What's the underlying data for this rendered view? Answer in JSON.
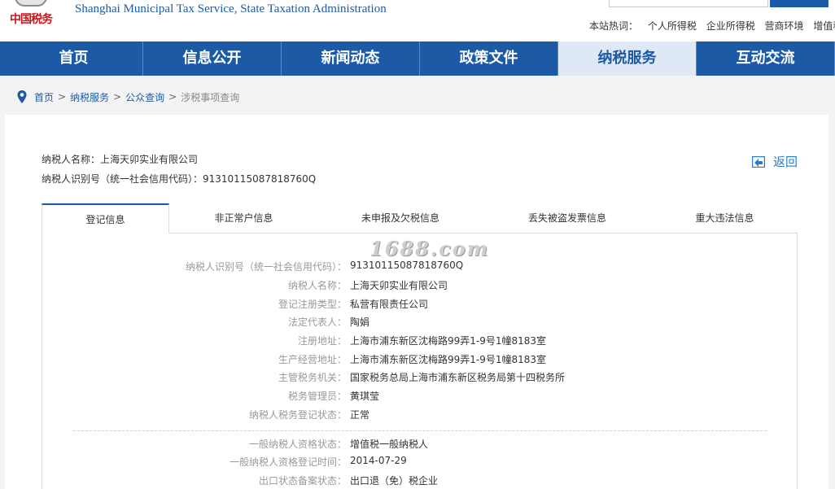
{
  "header": {
    "logo_text": "中国税务",
    "subtitle": "Shanghai Municipal Tax Service, State Taxation Administration",
    "hotwords_label": "本站热词：",
    "hotwords": [
      "个人所得税",
      "企业所得税",
      "营商环境",
      "增值税"
    ]
  },
  "nav": {
    "items": [
      "首页",
      "信息公开",
      "新闻动态",
      "政策文件",
      "纳税服务",
      "互动交流"
    ],
    "active": "纳税服务"
  },
  "breadcrumb": {
    "items": [
      "首页",
      "纳税服务",
      "公众查询"
    ],
    "current": "涉税事项查询",
    "separator": ">"
  },
  "summary": {
    "name_line": "纳税人名称：上海天卯实业有限公司",
    "id_line": "纳税人识别号（统一社会信用代码）：91310115087818760Q",
    "back_label": "返回"
  },
  "tabs": [
    "登记信息",
    "非正常户信息",
    "未申报及欠税信息",
    "丢失被盗发票信息",
    "重大违法信息"
  ],
  "watermark": "1688.com",
  "details": [
    {
      "label": "纳税人识别号（统一社会信用代码）：",
      "value": "91310115087818760Q"
    },
    {
      "label": "纳税人名称：",
      "value": "上海天卯实业有限公司"
    },
    {
      "label": "登记注册类型：",
      "value": "私营有限责任公司"
    },
    {
      "label": "法定代表人：",
      "value": "陶娟"
    },
    {
      "label": "注册地址：",
      "value": "上海市浦东新区沈梅路99弄1-9号1幢8183室"
    },
    {
      "label": "生产经营地址：",
      "value": "上海市浦东新区沈梅路99弄1-9号1幢8183室"
    },
    {
      "label": "主管税务机关：",
      "value": "国家税务总局上海市浦东新区税务局第十四税务所"
    },
    {
      "label": "税务管理员：",
      "value": "黄琪莹"
    },
    {
      "label": "纳税人税务登记状态：",
      "value": "正常"
    }
  ],
  "details2": [
    {
      "label": "一般纳税人资格状态：",
      "value": "增值税一般纳税人"
    },
    {
      "label": "一般纳税人资格登记时间：",
      "value": "2014-07-29"
    },
    {
      "label": "出口状态备案状态：",
      "value": "出口退（免）税企业"
    }
  ],
  "colors": {
    "brand_blue": "#1c5aa6",
    "logo_red": "#c8161d",
    "link_blue": "#2c7bc8"
  }
}
